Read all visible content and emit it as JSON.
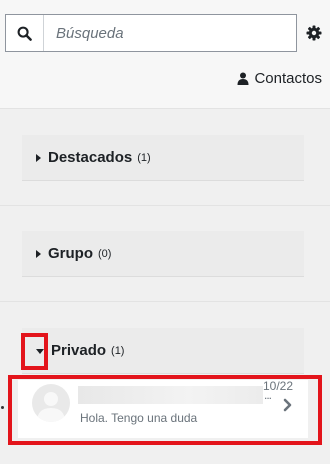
{
  "search": {
    "placeholder": "Búsqueda"
  },
  "header": {
    "contacts_label": "Contactos"
  },
  "sections": [
    {
      "title": "Destacados",
      "count": "(1)",
      "expanded": false
    },
    {
      "title": "Grupo",
      "count": "(0)",
      "expanded": false
    },
    {
      "title": "Privado",
      "count": "(1)",
      "expanded": true
    }
  ],
  "conversation": {
    "date": "10/22",
    "preview": "Hola. Tengo una duda"
  },
  "colors": {
    "highlight": "#e3141b"
  },
  "icons": [
    "search-icon",
    "gear-icon",
    "user-icon",
    "caret-right-icon",
    "caret-down-icon",
    "chevron-right-icon"
  ]
}
